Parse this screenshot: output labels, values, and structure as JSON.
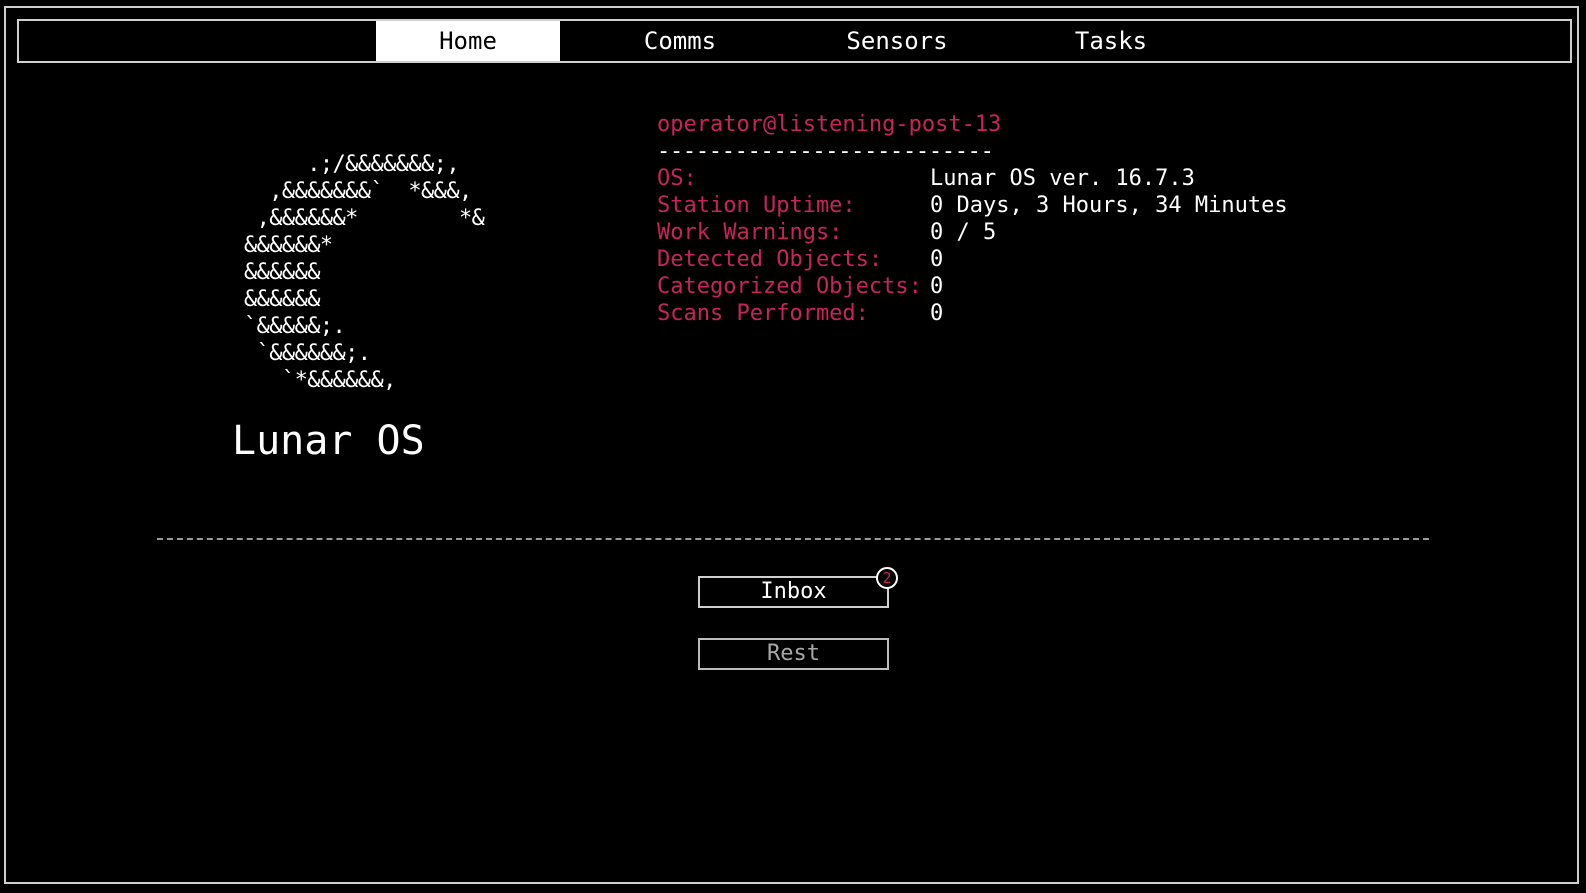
{
  "tabs": [
    {
      "label": "Home",
      "active": true
    },
    {
      "label": "Comms",
      "active": false
    },
    {
      "label": "Sensors",
      "active": false
    },
    {
      "label": "Tasks",
      "active": false
    }
  ],
  "logo": {
    "ascii_art": "     .;/&&&&&&&;,\n  ,&&&&&&&`  *&&&,\n ,&&&&&&*        *&\n&&&&&&*\n&&&&&&\n&&&&&&\n`&&&&&;.\n `&&&&&&;.\n   `*&&&&&&,",
    "title": "Lunar OS"
  },
  "info": {
    "user_host": "operator@listening-post-13",
    "separator": "--------------------------",
    "rows": [
      {
        "key": "OS:",
        "value": "Lunar OS ver. 16.7.3"
      },
      {
        "key": "Station Uptime:",
        "value": "0 Days, 3 Hours, 34 Minutes"
      },
      {
        "key": "Work Warnings:",
        "value": "0 / 5"
      },
      {
        "key": "Detected Objects:",
        "value": "0"
      },
      {
        "key": "Categorized Objects:",
        "value": "0"
      },
      {
        "key": "Scans Performed:",
        "value": "0"
      }
    ]
  },
  "actions": {
    "inbox_label": "Inbox",
    "inbox_count": "2",
    "rest_label": "Rest"
  },
  "colors": {
    "accent": "#c7245c",
    "background": "#000000",
    "foreground": "#ffffff",
    "border": "#cfcfcf"
  }
}
